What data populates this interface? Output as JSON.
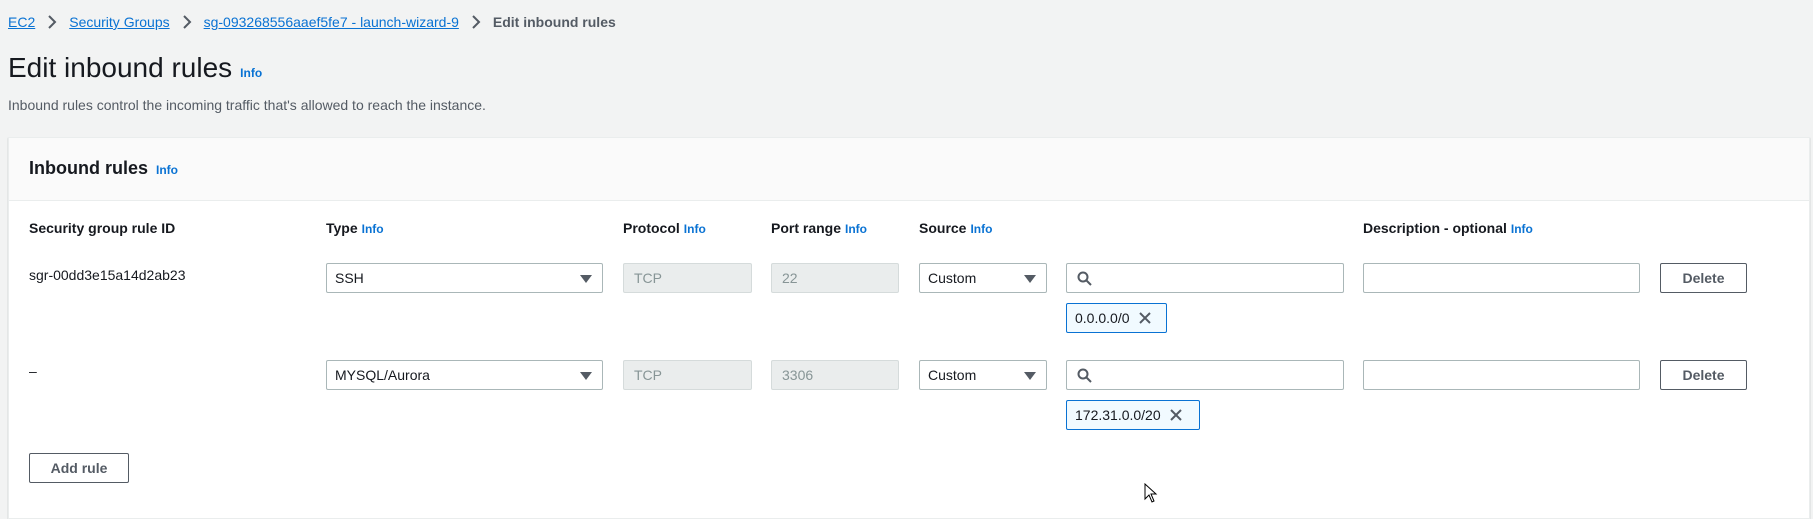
{
  "breadcrumb": {
    "items": [
      "EC2",
      "Security Groups",
      "sg-093268556aaef5fe7 - launch-wizard-9"
    ],
    "current": "Edit inbound rules"
  },
  "page": {
    "title": "Edit inbound rules",
    "info": "Info",
    "description": "Inbound rules control the incoming traffic that's allowed to reach the instance."
  },
  "panel": {
    "title": "Inbound rules",
    "info": "Info",
    "columns": {
      "rule_id": "Security group rule ID",
      "type": "Type",
      "protocol": "Protocol",
      "port_range": "Port range",
      "source": "Source",
      "description": "Description - optional",
      "info": "Info"
    },
    "rules": [
      {
        "rule_id": "sgr-00dd3e15a14d2ab23",
        "type": "SSH",
        "protocol": "TCP",
        "port_range": "22",
        "source": "Custom",
        "search_value": "",
        "token": "0.0.0.0/0",
        "description": "",
        "delete_label": "Delete"
      },
      {
        "rule_id": "–",
        "type": "MYSQL/Aurora",
        "protocol": "TCP",
        "port_range": "3306",
        "source": "Custom",
        "search_value": "",
        "token": "172.31.0.0/20",
        "description": "",
        "delete_label": "Delete"
      }
    ],
    "add_rule_label": "Add rule"
  },
  "colors": {
    "link": "#0972d3",
    "background": "#f2f3f3",
    "token_bg": "#f1faff"
  },
  "icons": [
    "chevron-right-icon",
    "caret-down-icon",
    "search-icon",
    "close-icon",
    "mouse-cursor-icon"
  ]
}
